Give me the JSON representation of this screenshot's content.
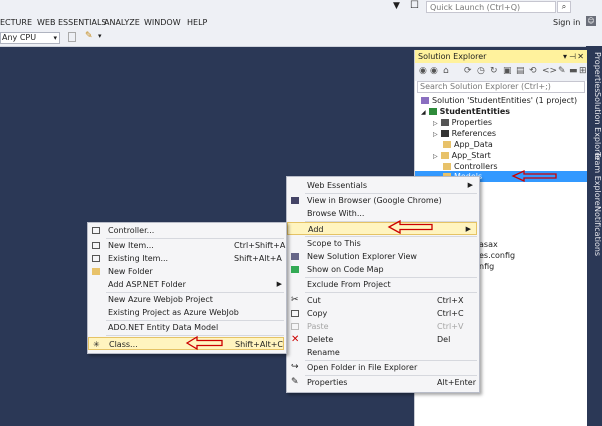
{
  "menu_bar": {
    "items": [
      "ECTURE",
      "WEB ESSENTIALS",
      "ANALYZE",
      "WINDOW",
      "HELP"
    ],
    "quick_launch_placeholder": "Quick Launch (Ctrl+Q)",
    "sign_in": "Sign in"
  },
  "toolbar": {
    "platform": "Any CPU"
  },
  "side_tabs": [
    "Properties",
    "Solution Explorer",
    "Team Explorer",
    "Notifications"
  ],
  "solution_explorer": {
    "title": "Solution Explorer",
    "search_placeholder": "Search Solution Explorer (Ctrl+;)",
    "tree": [
      "Solution 'StudentEntities' (1 project)",
      "StudentEntities",
      "Properties",
      "References",
      "App_Data",
      "App_Start",
      "Controllers",
      "Models",
      "asax",
      "es.config",
      "nfig"
    ]
  },
  "context_menu": {
    "items": [
      {
        "label": "Web Essentials",
        "shortcut": "",
        "submenu": true
      },
      {
        "label": "View in Browser (Google Chrome)",
        "shortcut": ""
      },
      {
        "label": "Browse With...",
        "shortcut": ""
      },
      {
        "label": "Add",
        "shortcut": "",
        "submenu": true
      },
      {
        "label": "Scope to This",
        "shortcut": ""
      },
      {
        "label": "New Solution Explorer View",
        "shortcut": ""
      },
      {
        "label": "Show on Code Map",
        "shortcut": ""
      },
      {
        "label": "Exclude From Project",
        "shortcut": ""
      },
      {
        "label": "Cut",
        "shortcut": "Ctrl+X"
      },
      {
        "label": "Copy",
        "shortcut": "Ctrl+C"
      },
      {
        "label": "Paste",
        "shortcut": "Ctrl+V"
      },
      {
        "label": "Delete",
        "shortcut": "Del"
      },
      {
        "label": "Rename",
        "shortcut": ""
      },
      {
        "label": "Open Folder in File Explorer",
        "shortcut": ""
      },
      {
        "label": "Properties",
        "shortcut": "Alt+Enter"
      }
    ]
  },
  "add_submenu": {
    "items": [
      {
        "label": "Controller...",
        "shortcut": ""
      },
      {
        "label": "New Item...",
        "shortcut": "Ctrl+Shift+A"
      },
      {
        "label": "Existing Item...",
        "shortcut": "Shift+Alt+A"
      },
      {
        "label": "New Folder",
        "shortcut": ""
      },
      {
        "label": "Add ASP.NET Folder",
        "shortcut": "",
        "submenu": true
      },
      {
        "label": "New Azure Webjob Project",
        "shortcut": ""
      },
      {
        "label": "Existing Project as Azure WebJob",
        "shortcut": ""
      },
      {
        "label": "ADO.NET Entity Data Model",
        "shortcut": ""
      },
      {
        "label": "Class...",
        "shortcut": "Shift+Alt+C"
      }
    ]
  },
  "colors": {
    "background": "#2b3856",
    "highlight": "#fff4bf",
    "selection": "#3399ff",
    "title_bar": "#fff29d",
    "arrow": "#cc0000"
  }
}
